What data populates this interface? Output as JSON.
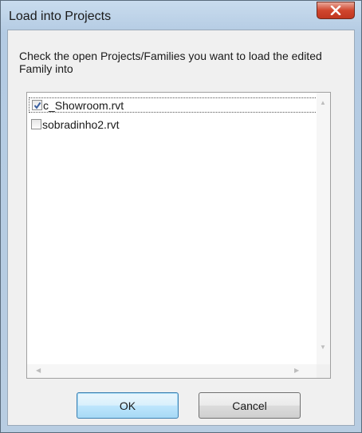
{
  "dialog": {
    "title": "Load into Projects",
    "instructions": "Check the open Projects/Families you want to load the edited Family into"
  },
  "projects": [
    {
      "name": "c_Showroom.rvt",
      "checked": true
    },
    {
      "name": "sobradinho2.rvt",
      "checked": false
    }
  ],
  "buttons": {
    "ok_label": "OK",
    "cancel_label": "Cancel"
  },
  "icons": {
    "close": "close-icon",
    "check": "checkmark-icon"
  }
}
